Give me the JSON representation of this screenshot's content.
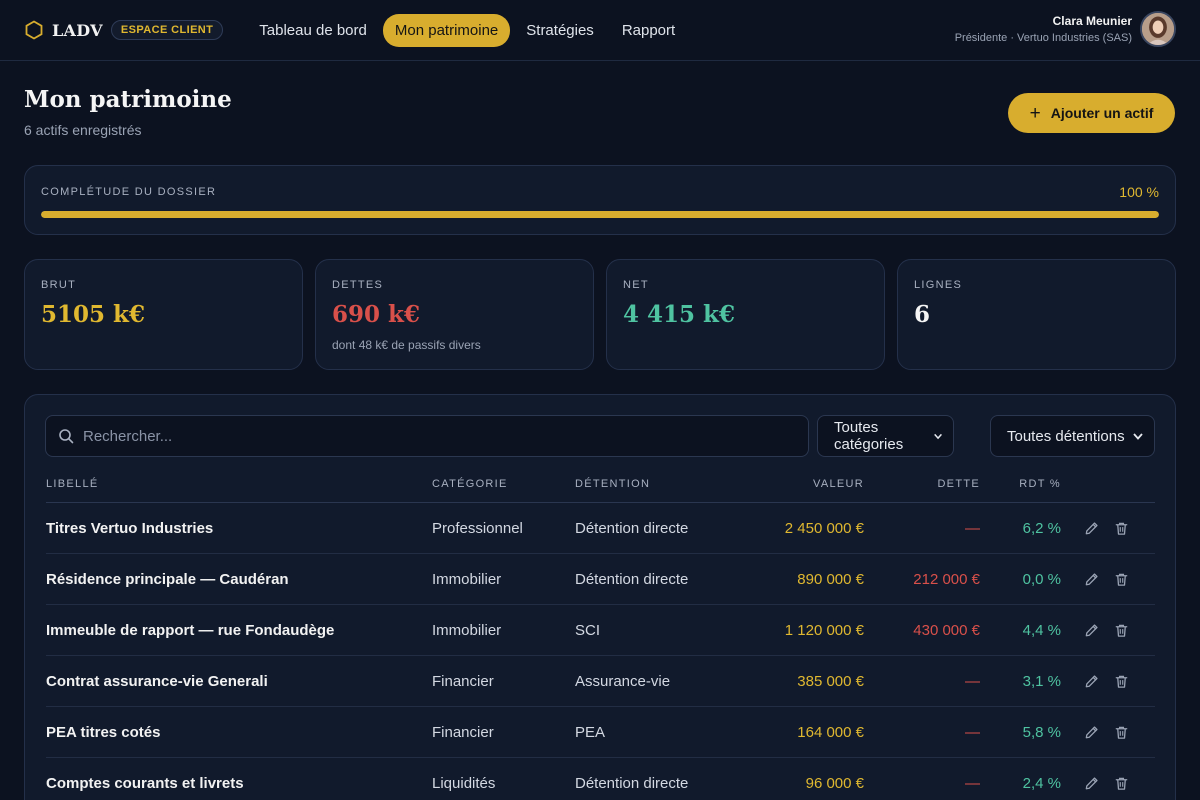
{
  "brand": {
    "name": "LADV",
    "badge": "ESPACE CLIENT",
    "accent": "#d8ad2e"
  },
  "nav": [
    {
      "label": "Tableau de bord",
      "active": false
    },
    {
      "label": "Mon patrimoine",
      "active": true
    },
    {
      "label": "Stratégies",
      "active": false
    },
    {
      "label": "Rapport",
      "active": false
    }
  ],
  "user": {
    "name": "Clara Meunier",
    "role": "Présidente · Vertuo Industries (SAS)"
  },
  "page": {
    "title": "Mon patrimoine",
    "subtitle": "6 actifs enregistrés",
    "add_label": "Ajouter un actif"
  },
  "completeness": {
    "label": "COMPLÉTUDE DU DOSSIER",
    "value_text": "100 %",
    "fraction": 1.0
  },
  "stats": [
    {
      "label": "BRUT",
      "value": "5105 k€",
      "note": "",
      "color": "#e0b830"
    },
    {
      "label": "DETTES",
      "value": "690 k€",
      "note": "dont 48 k€ de passifs divers",
      "color": "#d9504a"
    },
    {
      "label": "NET",
      "value": "4 415 k€",
      "note": "",
      "color": "#4fc3a1"
    },
    {
      "label": "LIGNES",
      "value": "6",
      "note": "",
      "color": "#f5f5f5"
    }
  ],
  "filters": {
    "search_placeholder": "Rechercher...",
    "category": "Toutes catégories",
    "holding": "Toutes détentions"
  },
  "table": {
    "headers": {
      "label": "LIBELLÉ",
      "category": "CATÉGORIE",
      "holding": "DÉTENTION",
      "value": "VALEUR",
      "debt": "DETTE",
      "yield": "RDT %"
    },
    "rows": [
      {
        "label": "Titres Vertuo Industries",
        "category": "Professionnel",
        "holding": "Détention directe",
        "value": "2 450 000 €",
        "debt": "—",
        "yield": "6,2 %"
      },
      {
        "label": "Résidence principale — Caudéran",
        "category": "Immobilier",
        "holding": "Détention directe",
        "value": "890 000 €",
        "debt": "212 000 €",
        "yield": "0,0 %"
      },
      {
        "label": "Immeuble de rapport — rue Fondaudège",
        "category": "Immobilier",
        "holding": "SCI",
        "value": "1 120 000 €",
        "debt": "430 000 €",
        "yield": "4,4 %"
      },
      {
        "label": "Contrat assurance-vie Generali",
        "category": "Financier",
        "holding": "Assurance-vie",
        "value": "385 000 €",
        "debt": "—",
        "yield": "3,1 %"
      },
      {
        "label": "PEA titres cotés",
        "category": "Financier",
        "holding": "PEA",
        "value": "164 000 €",
        "debt": "—",
        "yield": "5,8 %"
      },
      {
        "label": "Comptes courants et livrets",
        "category": "Liquidités",
        "holding": "Détention directe",
        "value": "96 000 €",
        "debt": "—",
        "yield": "2,4 %"
      }
    ]
  },
  "icons": {
    "logo": "hexagon-icon",
    "search": "search-icon",
    "edit": "pencil-icon",
    "delete": "trash-icon",
    "add": "plus-icon",
    "dropdown": "chevron-down-icon"
  }
}
